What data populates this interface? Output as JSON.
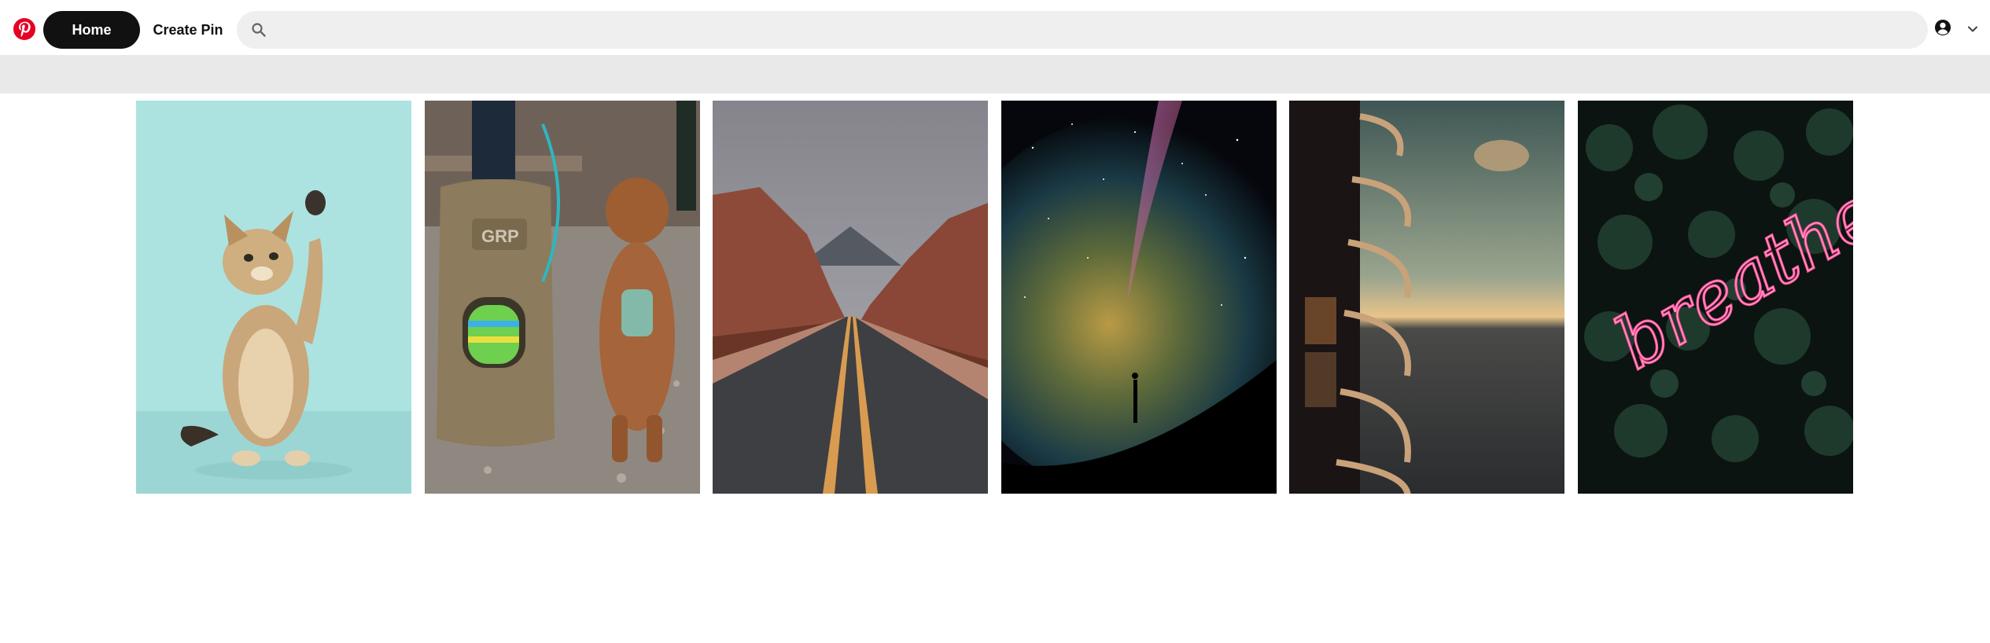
{
  "app": {
    "logo_icon": "pinterest-logo-icon",
    "brand_color": "#e60023"
  },
  "nav": {
    "home_label": "Home",
    "create_label": "Create Pin"
  },
  "search": {
    "icon": "search-icon",
    "placeholder": "",
    "value": ""
  },
  "header_right": {
    "profile_icon": "user-circle-icon",
    "menu_icon": "chevron-down-icon"
  },
  "pins": [
    {
      "subject": "kitten",
      "background": "#a8e2e0"
    },
    {
      "subject": "dog-with-backpack",
      "background": "#9a8f86"
    },
    {
      "subject": "desert-road",
      "background": "#5a4a44"
    },
    {
      "subject": "milky-way",
      "background": "#0a0d14"
    },
    {
      "subject": "balcony-sunset",
      "background": "#4d5a55"
    },
    {
      "subject": "neon-breathe-sign",
      "background": "#0d1a16"
    }
  ],
  "colors": {
    "home_bg": "#111111",
    "search_bg": "#efefef",
    "subbar_bg": "#e9e9e9"
  }
}
